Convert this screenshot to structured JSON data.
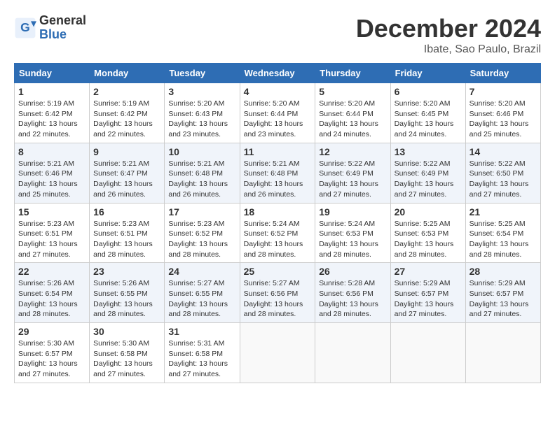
{
  "header": {
    "logo_line1": "General",
    "logo_line2": "Blue",
    "month_year": "December 2024",
    "location": "Ibate, Sao Paulo, Brazil"
  },
  "weekdays": [
    "Sunday",
    "Monday",
    "Tuesday",
    "Wednesday",
    "Thursday",
    "Friday",
    "Saturday"
  ],
  "weeks": [
    [
      {
        "day": "1",
        "info": "Sunrise: 5:19 AM\nSunset: 6:42 PM\nDaylight: 13 hours\nand 22 minutes."
      },
      {
        "day": "2",
        "info": "Sunrise: 5:19 AM\nSunset: 6:42 PM\nDaylight: 13 hours\nand 22 minutes."
      },
      {
        "day": "3",
        "info": "Sunrise: 5:20 AM\nSunset: 6:43 PM\nDaylight: 13 hours\nand 23 minutes."
      },
      {
        "day": "4",
        "info": "Sunrise: 5:20 AM\nSunset: 6:44 PM\nDaylight: 13 hours\nand 23 minutes."
      },
      {
        "day": "5",
        "info": "Sunrise: 5:20 AM\nSunset: 6:44 PM\nDaylight: 13 hours\nand 24 minutes."
      },
      {
        "day": "6",
        "info": "Sunrise: 5:20 AM\nSunset: 6:45 PM\nDaylight: 13 hours\nand 24 minutes."
      },
      {
        "day": "7",
        "info": "Sunrise: 5:20 AM\nSunset: 6:46 PM\nDaylight: 13 hours\nand 25 minutes."
      }
    ],
    [
      {
        "day": "8",
        "info": "Sunrise: 5:21 AM\nSunset: 6:46 PM\nDaylight: 13 hours\nand 25 minutes."
      },
      {
        "day": "9",
        "info": "Sunrise: 5:21 AM\nSunset: 6:47 PM\nDaylight: 13 hours\nand 26 minutes."
      },
      {
        "day": "10",
        "info": "Sunrise: 5:21 AM\nSunset: 6:48 PM\nDaylight: 13 hours\nand 26 minutes."
      },
      {
        "day": "11",
        "info": "Sunrise: 5:21 AM\nSunset: 6:48 PM\nDaylight: 13 hours\nand 26 minutes."
      },
      {
        "day": "12",
        "info": "Sunrise: 5:22 AM\nSunset: 6:49 PM\nDaylight: 13 hours\nand 27 minutes."
      },
      {
        "day": "13",
        "info": "Sunrise: 5:22 AM\nSunset: 6:49 PM\nDaylight: 13 hours\nand 27 minutes."
      },
      {
        "day": "14",
        "info": "Sunrise: 5:22 AM\nSunset: 6:50 PM\nDaylight: 13 hours\nand 27 minutes."
      }
    ],
    [
      {
        "day": "15",
        "info": "Sunrise: 5:23 AM\nSunset: 6:51 PM\nDaylight: 13 hours\nand 27 minutes."
      },
      {
        "day": "16",
        "info": "Sunrise: 5:23 AM\nSunset: 6:51 PM\nDaylight: 13 hours\nand 28 minutes."
      },
      {
        "day": "17",
        "info": "Sunrise: 5:23 AM\nSunset: 6:52 PM\nDaylight: 13 hours\nand 28 minutes."
      },
      {
        "day": "18",
        "info": "Sunrise: 5:24 AM\nSunset: 6:52 PM\nDaylight: 13 hours\nand 28 minutes."
      },
      {
        "day": "19",
        "info": "Sunrise: 5:24 AM\nSunset: 6:53 PM\nDaylight: 13 hours\nand 28 minutes."
      },
      {
        "day": "20",
        "info": "Sunrise: 5:25 AM\nSunset: 6:53 PM\nDaylight: 13 hours\nand 28 minutes."
      },
      {
        "day": "21",
        "info": "Sunrise: 5:25 AM\nSunset: 6:54 PM\nDaylight: 13 hours\nand 28 minutes."
      }
    ],
    [
      {
        "day": "22",
        "info": "Sunrise: 5:26 AM\nSunset: 6:54 PM\nDaylight: 13 hours\nand 28 minutes."
      },
      {
        "day": "23",
        "info": "Sunrise: 5:26 AM\nSunset: 6:55 PM\nDaylight: 13 hours\nand 28 minutes."
      },
      {
        "day": "24",
        "info": "Sunrise: 5:27 AM\nSunset: 6:55 PM\nDaylight: 13 hours\nand 28 minutes."
      },
      {
        "day": "25",
        "info": "Sunrise: 5:27 AM\nSunset: 6:56 PM\nDaylight: 13 hours\nand 28 minutes."
      },
      {
        "day": "26",
        "info": "Sunrise: 5:28 AM\nSunset: 6:56 PM\nDaylight: 13 hours\nand 28 minutes."
      },
      {
        "day": "27",
        "info": "Sunrise: 5:29 AM\nSunset: 6:57 PM\nDaylight: 13 hours\nand 27 minutes."
      },
      {
        "day": "28",
        "info": "Sunrise: 5:29 AM\nSunset: 6:57 PM\nDaylight: 13 hours\nand 27 minutes."
      }
    ],
    [
      {
        "day": "29",
        "info": "Sunrise: 5:30 AM\nSunset: 6:57 PM\nDaylight: 13 hours\nand 27 minutes."
      },
      {
        "day": "30",
        "info": "Sunrise: 5:30 AM\nSunset: 6:58 PM\nDaylight: 13 hours\nand 27 minutes."
      },
      {
        "day": "31",
        "info": "Sunrise: 5:31 AM\nSunset: 6:58 PM\nDaylight: 13 hours\nand 27 minutes."
      },
      {
        "day": "",
        "info": ""
      },
      {
        "day": "",
        "info": ""
      },
      {
        "day": "",
        "info": ""
      },
      {
        "day": "",
        "info": ""
      }
    ]
  ]
}
